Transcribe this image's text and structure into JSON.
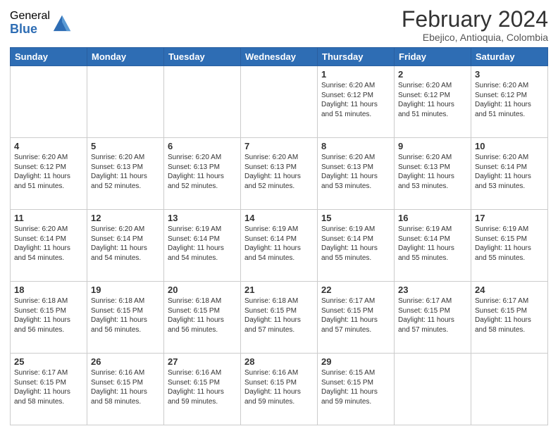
{
  "logo": {
    "general": "General",
    "blue": "Blue"
  },
  "title": "February 2024",
  "subtitle": "Ebejico, Antioquia, Colombia",
  "days_of_week": [
    "Sunday",
    "Monday",
    "Tuesday",
    "Wednesday",
    "Thursday",
    "Friday",
    "Saturday"
  ],
  "weeks": [
    [
      {
        "day": "",
        "info": ""
      },
      {
        "day": "",
        "info": ""
      },
      {
        "day": "",
        "info": ""
      },
      {
        "day": "",
        "info": ""
      },
      {
        "day": "1",
        "info": "Sunrise: 6:20 AM\nSunset: 6:12 PM\nDaylight: 11 hours\nand 51 minutes."
      },
      {
        "day": "2",
        "info": "Sunrise: 6:20 AM\nSunset: 6:12 PM\nDaylight: 11 hours\nand 51 minutes."
      },
      {
        "day": "3",
        "info": "Sunrise: 6:20 AM\nSunset: 6:12 PM\nDaylight: 11 hours\nand 51 minutes."
      }
    ],
    [
      {
        "day": "4",
        "info": "Sunrise: 6:20 AM\nSunset: 6:12 PM\nDaylight: 11 hours\nand 51 minutes."
      },
      {
        "day": "5",
        "info": "Sunrise: 6:20 AM\nSunset: 6:13 PM\nDaylight: 11 hours\nand 52 minutes."
      },
      {
        "day": "6",
        "info": "Sunrise: 6:20 AM\nSunset: 6:13 PM\nDaylight: 11 hours\nand 52 minutes."
      },
      {
        "day": "7",
        "info": "Sunrise: 6:20 AM\nSunset: 6:13 PM\nDaylight: 11 hours\nand 52 minutes."
      },
      {
        "day": "8",
        "info": "Sunrise: 6:20 AM\nSunset: 6:13 PM\nDaylight: 11 hours\nand 53 minutes."
      },
      {
        "day": "9",
        "info": "Sunrise: 6:20 AM\nSunset: 6:13 PM\nDaylight: 11 hours\nand 53 minutes."
      },
      {
        "day": "10",
        "info": "Sunrise: 6:20 AM\nSunset: 6:14 PM\nDaylight: 11 hours\nand 53 minutes."
      }
    ],
    [
      {
        "day": "11",
        "info": "Sunrise: 6:20 AM\nSunset: 6:14 PM\nDaylight: 11 hours\nand 54 minutes."
      },
      {
        "day": "12",
        "info": "Sunrise: 6:20 AM\nSunset: 6:14 PM\nDaylight: 11 hours\nand 54 minutes."
      },
      {
        "day": "13",
        "info": "Sunrise: 6:19 AM\nSunset: 6:14 PM\nDaylight: 11 hours\nand 54 minutes."
      },
      {
        "day": "14",
        "info": "Sunrise: 6:19 AM\nSunset: 6:14 PM\nDaylight: 11 hours\nand 54 minutes."
      },
      {
        "day": "15",
        "info": "Sunrise: 6:19 AM\nSunset: 6:14 PM\nDaylight: 11 hours\nand 55 minutes."
      },
      {
        "day": "16",
        "info": "Sunrise: 6:19 AM\nSunset: 6:14 PM\nDaylight: 11 hours\nand 55 minutes."
      },
      {
        "day": "17",
        "info": "Sunrise: 6:19 AM\nSunset: 6:15 PM\nDaylight: 11 hours\nand 55 minutes."
      }
    ],
    [
      {
        "day": "18",
        "info": "Sunrise: 6:18 AM\nSunset: 6:15 PM\nDaylight: 11 hours\nand 56 minutes."
      },
      {
        "day": "19",
        "info": "Sunrise: 6:18 AM\nSunset: 6:15 PM\nDaylight: 11 hours\nand 56 minutes."
      },
      {
        "day": "20",
        "info": "Sunrise: 6:18 AM\nSunset: 6:15 PM\nDaylight: 11 hours\nand 56 minutes."
      },
      {
        "day": "21",
        "info": "Sunrise: 6:18 AM\nSunset: 6:15 PM\nDaylight: 11 hours\nand 57 minutes."
      },
      {
        "day": "22",
        "info": "Sunrise: 6:17 AM\nSunset: 6:15 PM\nDaylight: 11 hours\nand 57 minutes."
      },
      {
        "day": "23",
        "info": "Sunrise: 6:17 AM\nSunset: 6:15 PM\nDaylight: 11 hours\nand 57 minutes."
      },
      {
        "day": "24",
        "info": "Sunrise: 6:17 AM\nSunset: 6:15 PM\nDaylight: 11 hours\nand 58 minutes."
      }
    ],
    [
      {
        "day": "25",
        "info": "Sunrise: 6:17 AM\nSunset: 6:15 PM\nDaylight: 11 hours\nand 58 minutes."
      },
      {
        "day": "26",
        "info": "Sunrise: 6:16 AM\nSunset: 6:15 PM\nDaylight: 11 hours\nand 58 minutes."
      },
      {
        "day": "27",
        "info": "Sunrise: 6:16 AM\nSunset: 6:15 PM\nDaylight: 11 hours\nand 59 minutes."
      },
      {
        "day": "28",
        "info": "Sunrise: 6:16 AM\nSunset: 6:15 PM\nDaylight: 11 hours\nand 59 minutes."
      },
      {
        "day": "29",
        "info": "Sunrise: 6:15 AM\nSunset: 6:15 PM\nDaylight: 11 hours\nand 59 minutes."
      },
      {
        "day": "",
        "info": ""
      },
      {
        "day": "",
        "info": ""
      }
    ]
  ]
}
